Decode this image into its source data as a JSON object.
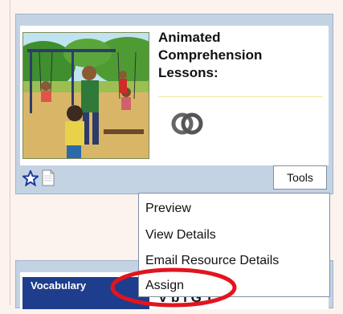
{
  "card": {
    "title_lines": [
      "Animated",
      "Comprehension",
      "Lessons:"
    ],
    "tools_label": "Tools"
  },
  "menu": {
    "items": [
      "Preview",
      "View Details",
      "Email Resource Details",
      "Assign"
    ]
  },
  "card2": {
    "thumb_label": "Vocabulary",
    "title_partial": "V        b  l     G    1"
  },
  "colors": {
    "card_bg": "#c4d3e4",
    "highlight": "#e3141e",
    "star": "#1c3c9a"
  }
}
